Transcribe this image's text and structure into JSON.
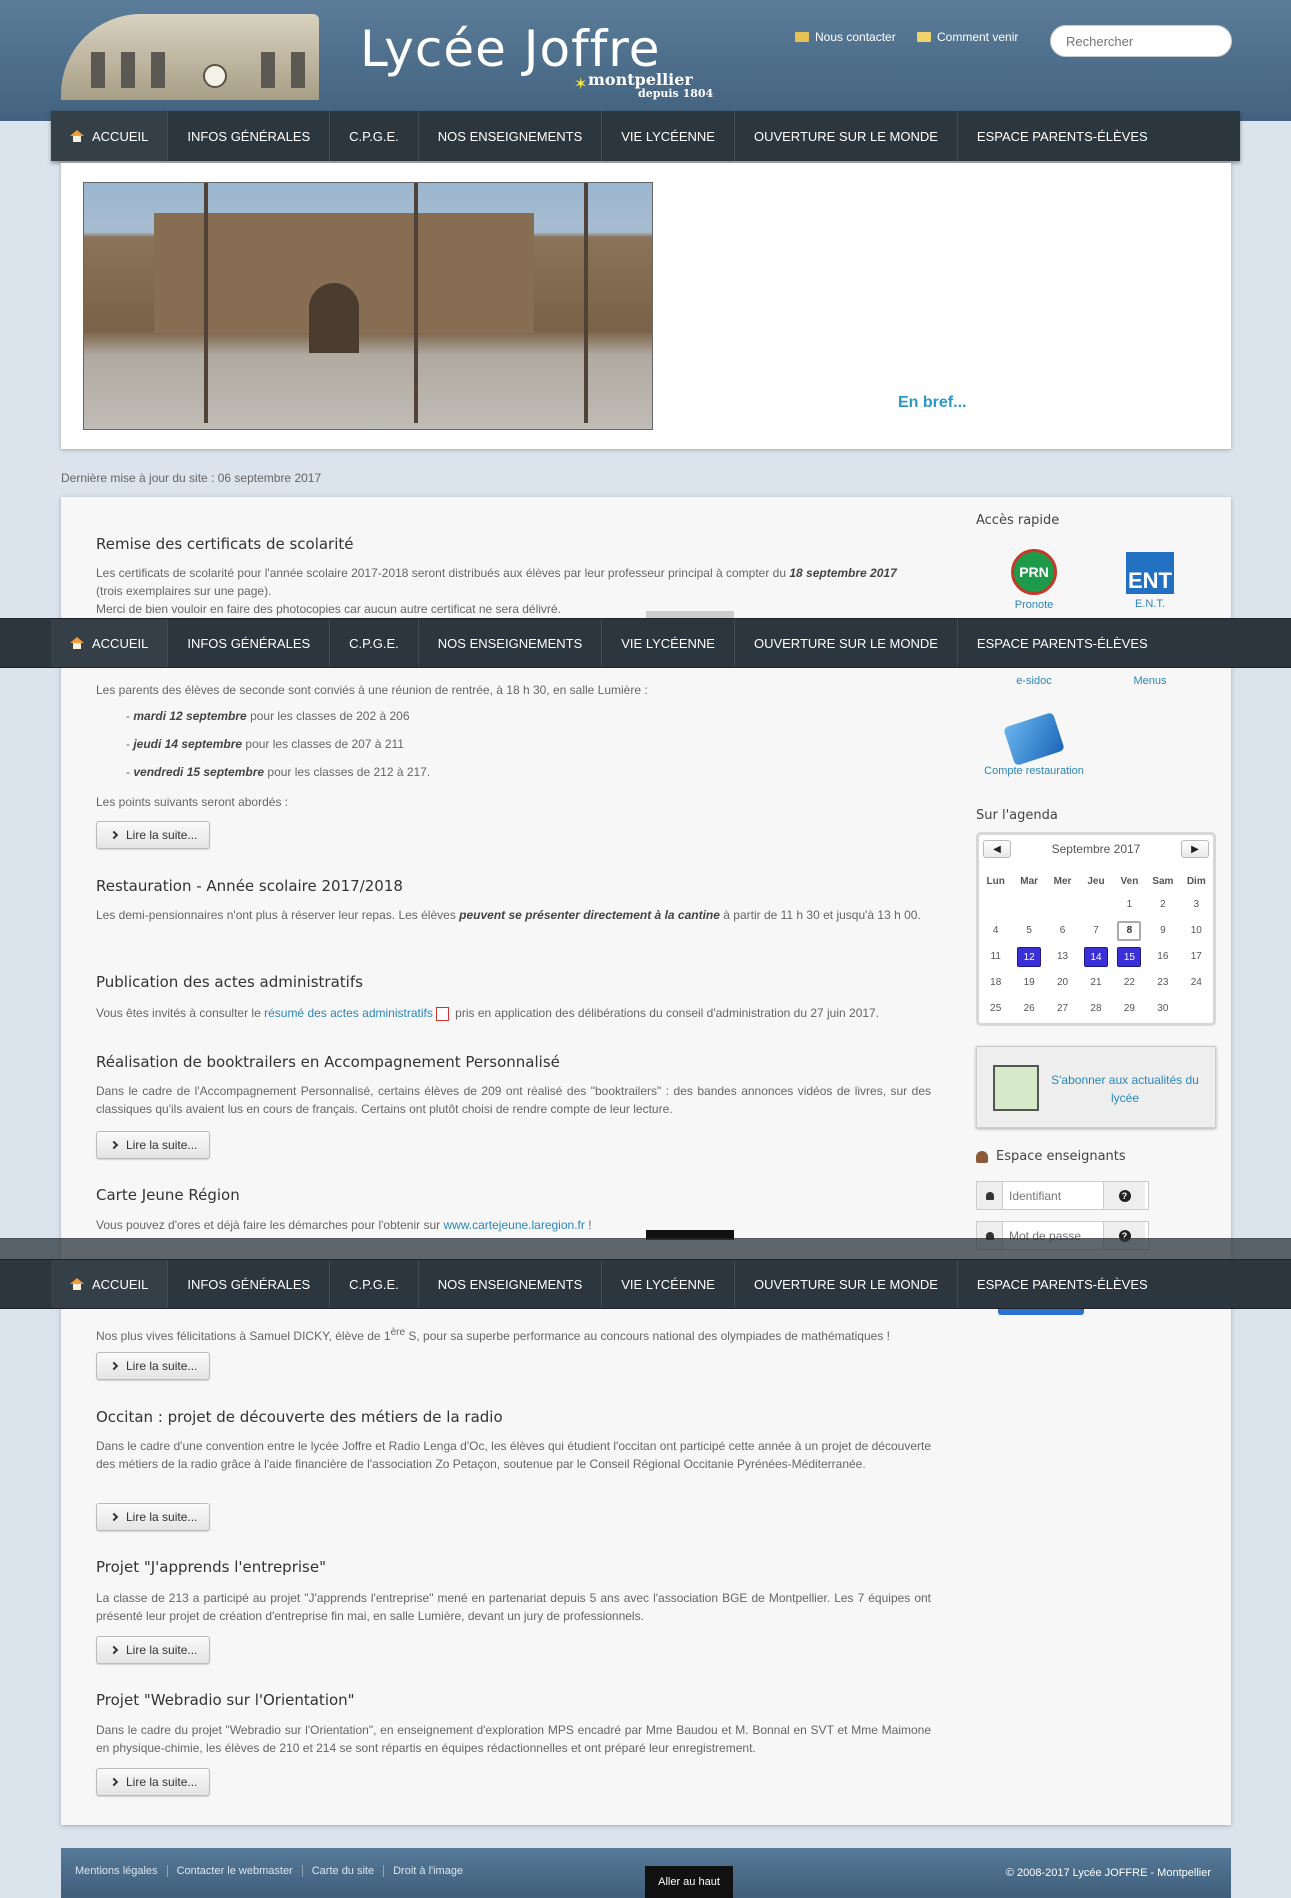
{
  "header": {
    "logo_title": "Lycée Joffre",
    "logo_city": "montpellier",
    "logo_since": "depuis 1804",
    "contact_label": "Nous contacter",
    "directions_label": "Comment venir",
    "search_placeholder": "Rechercher"
  },
  "nav": [
    "ACCUEIL",
    "INFOS GÉNÉRALES",
    "C.P.G.E.",
    "NOS ENSEIGNEMENTS",
    "VIE LYCÉENNE",
    "OUVERTURE SUR LE MONDE",
    "ESPACE PARENTS-ÉLÈVES"
  ],
  "slider": {
    "caption": "En bref..."
  },
  "update_text": "Dernière mise à jour du site : 06 septembre 2017",
  "articles": {
    "a1": {
      "title": "Remise des certificats de scolarité",
      "text1": "Les certificats de scolarité pour l'année scolaire 2017-2018 seront distribués aux élèves par leur professeur principal à compter du ",
      "text1_bold": "18 septembre 2017",
      "text2": "(trois exemplaires sur une page).",
      "text3": "Merci de bien vouloir en faire des photocopies car aucun autre certificat ne sera délivré."
    },
    "a2": {
      "text": "Les parents des élèves de seconde sont conviés à une réunion de rentrée, à 18 h 30, en salle Lumière :",
      "b1_bold": "mardi 12 septembre",
      "b1_rest": " pour les classes de 202 à 206",
      "b2_bold": "jeudi 14 septembre",
      "b2_rest": " pour les classes de 207 à 211",
      "b3_bold": "vendredi 15 septembre",
      "b3_rest": " pour les classes de 212 à 217.",
      "text2": "Les points suivants seront abordés :"
    },
    "a3": {
      "title": "Restauration - Année scolaire 2017/2018",
      "text1": "Les demi-pensionnaires n'ont plus à réserver leur repas. Les élèves ",
      "text_bold": "peuvent se présenter directement à la cantine",
      "text2": " à partir de 11 h 30 et jusqu'à 13 h 00."
    },
    "a4": {
      "title": "Publication des actes administratifs",
      "text1": "Vous êtes invités à consulter le ",
      "link": "résumé des actes administratifs",
      "text2": " pris en application des délibérations du conseil d'administration du 27 juin 2017."
    },
    "a5": {
      "title": "Réalisation de booktrailers en Accompagnement Personnalisé",
      "text": "Dans le cadre de l'Accompagnement Personnalisé, certains élèves de 209 ont réalisé des \"booktrailers\" : des bandes annonces vidéos de livres, sur des classiques qu'ils avaient lus en cours de français. Certains ont plutôt choisi de rendre compte de leur lecture."
    },
    "a6": {
      "title": "Carte Jeune Région",
      "text1": "Vous pouvez d'ores et déjà faire les démarches pour l'obtenir sur ",
      "link": "www.cartejeune.laregion.fr",
      "text2": " !"
    },
    "a7": {
      "text1": "Nos plus vives félicitations à Samuel DICKY, élève de 1",
      "sup": "ère",
      "text2": " S, pour sa superbe performance au concours national des olympiades de mathématiques !"
    },
    "a8": {
      "title": "Occitan : projet de découverte des métiers de la radio",
      "text": "Dans le cadre d'une convention entre le lycée Joffre et Radio Lenga d'Oc, les élèves qui étudient l'occitan ont participé cette année à un projet de découverte des métiers de la radio grâce à l'aide financière de l'association Zo Petaçon, soutenue par le Conseil Régional Occitanie Pyrénées-Méditerranée."
    },
    "a9": {
      "title": "Projet \"J'apprends l'entreprise\"",
      "text": "La classe de 213 a participé au projet \"J'apprends l'entreprise\" mené en partenariat depuis 5 ans avec l'association BGE de Montpellier. Les 7 équipes ont présenté leur projet de création d'entreprise fin mai, en salle Lumière, devant un jury de professionnels."
    },
    "a10": {
      "title": "Projet \"Webradio sur l'Orientation\"",
      "text": "Dans le cadre du projet \"Webradio sur l'Orientation\", en enseignement d'exploration MPS encadré par Mme Baudou et M. Bonnal en SVT et Mme Maimone en physique-chimie, les élèves de 210 et 214 se sont répartis en équipes rédactionnelles et ont préparé leur enregistrement."
    },
    "read_more": "Lire la suite..."
  },
  "sidebar": {
    "quick_access_title": "Accès rapide",
    "quick": {
      "pronote": "Pronote",
      "prn": "PRN",
      "ent": "E.N.T.",
      "ent_logo": "ENT",
      "esidoc": "e-sidoc",
      "menus": "Menus",
      "compte": "Compte restauration"
    },
    "agenda_title": "Sur l'agenda",
    "calendar": {
      "month": "Septembre 2017",
      "prev": "◀",
      "next": "▶",
      "days": [
        "Lun",
        "Mar",
        "Mer",
        "Jeu",
        "Ven",
        "Sam",
        "Dim"
      ],
      "offset": 4,
      "count": 30,
      "highlight": [
        12,
        14,
        15
      ],
      "today": 8
    },
    "subscribe": "S'abonner aux actualités du lycée",
    "teachers_title": "Espace enseignants",
    "login_placeholder": "Identifiant",
    "password_placeholder": "Mot de passe"
  },
  "footer": {
    "links": [
      "Mentions légales",
      "Contacter le webmaster",
      "Carte du site",
      "Droit à l'image"
    ],
    "copyright": "© 2008-2017 Lycée JOFFRE - Montpellier",
    "to_top": "Aller au haut"
  },
  "colors": {
    "nav_bg": "#2c363e",
    "link": "#2b86b9",
    "calendar_highlight": "#3b2fd8"
  }
}
